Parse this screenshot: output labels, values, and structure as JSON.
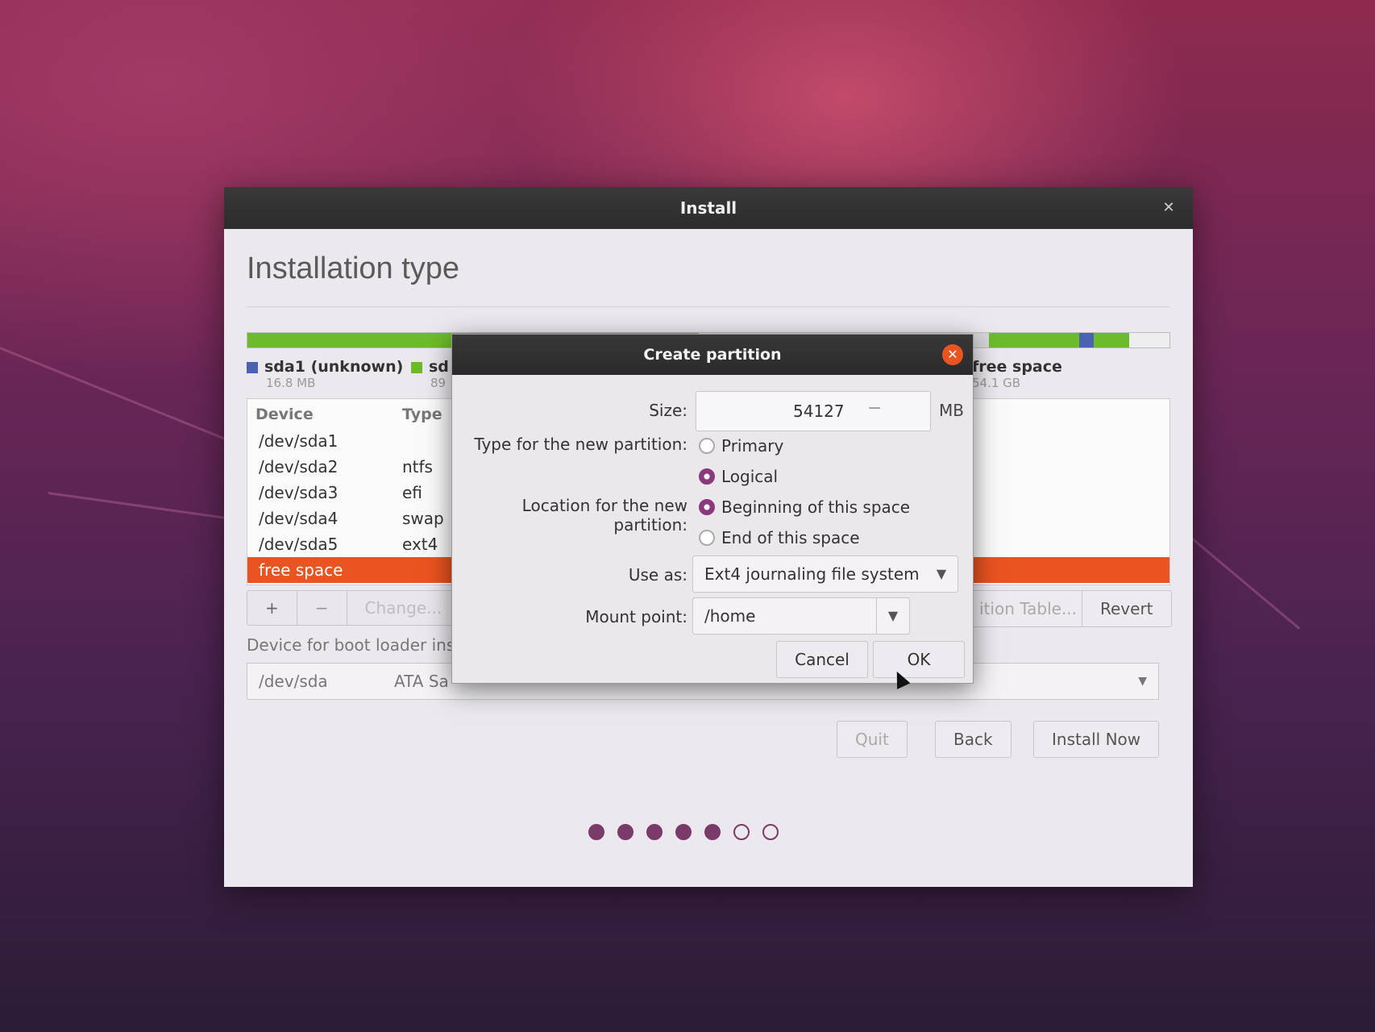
{
  "window": {
    "title": "Install",
    "close_icon": "close-icon"
  },
  "page": {
    "title": "Installation type"
  },
  "partition_bar": {
    "colors": {
      "unknown": "#4a63b0",
      "ntfs": "#6dbb2c",
      "free": "#d8d5da"
    }
  },
  "legend": [
    {
      "label": "sda1 (unknown)",
      "size": "16.8 MB",
      "color": "#4a63b0"
    },
    {
      "label": "sd",
      "size": "89",
      "color": "#6dbb2c"
    },
    {
      "label": "free space",
      "size": "54.1 GB",
      "color": "#ffffff"
    }
  ],
  "table": {
    "headers": {
      "device": "Device",
      "type": "Type"
    },
    "rows": [
      {
        "device": "/dev/sda1",
        "type": ""
      },
      {
        "device": "/dev/sda2",
        "type": "ntfs"
      },
      {
        "device": "/dev/sda3",
        "type": "efi"
      },
      {
        "device": "/dev/sda4",
        "type": "swap"
      },
      {
        "device": "/dev/sda5",
        "type": "ext4"
      },
      {
        "device": "free space",
        "type": ""
      }
    ]
  },
  "table_buttons": {
    "add": "+",
    "remove": "−",
    "change": "Change..."
  },
  "partition_buttons": {
    "new_table": "ition Table...",
    "revert": "Revert"
  },
  "bootloader": {
    "label": "Device for boot loader inst",
    "device": "/dev/sda",
    "description": "ATA Sa"
  },
  "nav_buttons": {
    "quit": "Quit",
    "back": "Back",
    "install_now": "Install Now"
  },
  "progress": {
    "total_steps": 7,
    "current_step": 5
  },
  "dialog": {
    "title": "Create partition",
    "size_label": "Size:",
    "size_value": "54127",
    "size_unit": "MB",
    "type_label": "Type for the new partition:",
    "type_options": [
      "Primary",
      "Logical"
    ],
    "type_selected": "Logical",
    "location_label": "Location for the new partition:",
    "location_options": [
      "Beginning of this space",
      "End of this space"
    ],
    "location_selected": "Beginning of this space",
    "use_as_label": "Use as:",
    "use_as_value": "Ext4 journaling file system",
    "mount_label": "Mount point:",
    "mount_value": "/home",
    "cancel": "Cancel",
    "ok": "OK"
  },
  "accent_color": "#e95420"
}
